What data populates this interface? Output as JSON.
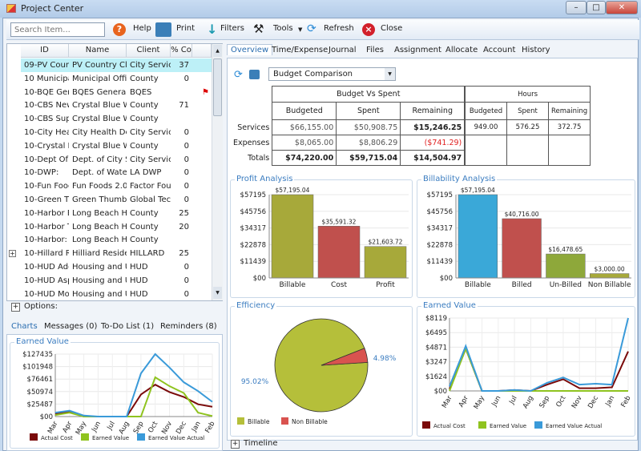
{
  "window": {
    "title": "Project Center",
    "controls": [
      "–",
      "□",
      "✕"
    ]
  },
  "toolbar": {
    "search_placeholder": "Search Item...",
    "help": "Help",
    "print": "Print",
    "filters": "Filters",
    "tools": "Tools",
    "refresh": "Refresh",
    "close": "Close"
  },
  "grid": {
    "columns": [
      "ID",
      "Name",
      "Client",
      "% Co",
      ""
    ],
    "rows": [
      [
        "09-PV Count",
        "PV Country Clu",
        "City Servic",
        "37"
      ],
      [
        "10 Municipal",
        "Municipal Offic",
        "County",
        "0"
      ],
      [
        "10-BQE Gen",
        "BQES General",
        "BQES",
        ""
      ],
      [
        "10-CBS New",
        "Crystal Blue Wa",
        "County",
        "71"
      ],
      [
        "10-CBS Supp",
        "Crystal Blue Wa",
        "County",
        ""
      ],
      [
        "10-City Healt",
        "City Health Dep",
        "City Servic",
        "0"
      ],
      [
        "10-Crystal Bl",
        "Crystal Blue Wa",
        "County",
        "0"
      ],
      [
        "10-Dept Of",
        "Dept. of City Se",
        "City Servic",
        "0"
      ],
      [
        "10-DWP:",
        "Dept. of Water",
        "LA DWP",
        "0"
      ],
      [
        "10-Fun Food",
        "Fun Foods 2.0",
        "Factor Fou",
        "0"
      ],
      [
        "10-Green Th",
        "Green Thumb S",
        "Global Tec",
        "0"
      ],
      [
        "10-Harbor Bl",
        "Long Beach Har",
        "County",
        "25"
      ],
      [
        "10-Harbor T",
        "Long Beach Har",
        "County",
        "20"
      ],
      [
        "10-Harbor:",
        "Long Beach Har",
        "County",
        ""
      ],
      [
        "10-Hillard Re",
        "Hilliard Residen",
        "HILLARD",
        "25"
      ],
      [
        "10-HUD Add",
        "Housing and Ur",
        "HUD",
        "0"
      ],
      [
        "10-HUD Asp",
        "Housing and Ur",
        "HUD",
        "0"
      ],
      [
        "10-HUD Mo",
        "Housing and Ur",
        "HUD",
        "0"
      ]
    ]
  },
  "options_label": "Options:",
  "bottom_tabs": [
    "Charts",
    "Messages  (0)",
    "To-Do List  (1)",
    "Reminders  (8)"
  ],
  "main_tabs": [
    "Overview",
    "Time/Expense",
    "Journal",
    "Files",
    "Assignment",
    "Allocate",
    "Account",
    "History"
  ],
  "report_select": "Budget Comparison",
  "budget": {
    "title": "Budget Vs Spent",
    "headers": [
      "Budgeted",
      "Spent",
      "Remaining"
    ],
    "rows": [
      {
        "label": "Services",
        "values": [
          "$66,155.00",
          "$50,908.75",
          "$15,246.25"
        ]
      },
      {
        "label": "Expenses",
        "values": [
          "$8,065.00",
          "$8,806.29",
          "($741.29)"
        ]
      },
      {
        "label": "Totals",
        "values": [
          "$74,220.00",
          "$59,715.04",
          "$14,504.97"
        ]
      }
    ],
    "negative_color": "#e02020"
  },
  "hours": {
    "title": "Hours",
    "headers": [
      "Budgeted",
      "Spent",
      "Remaining"
    ],
    "values": [
      "949.00",
      "576.25",
      "372.75"
    ]
  },
  "timeline_label": "Timeline",
  "chart_data": [
    {
      "id": "profit",
      "type": "bar",
      "title": "Profit Analysis",
      "categories": [
        "Billable",
        "Cost",
        "Profit"
      ],
      "values": [
        57195.04,
        35591.32,
        21603.72
      ],
      "labels": [
        "$57,195.04",
        "$35,591.32",
        "$21,603.72"
      ],
      "yticks": [
        "$00",
        "$11439",
        "$22878",
        "$34317",
        "$45756",
        "$57195"
      ],
      "ylim": [
        0,
        57195
      ],
      "colors": [
        "#a7a93a",
        "#c0504d",
        "#a7a93a"
      ]
    },
    {
      "id": "billability",
      "type": "bar",
      "title": "Billability Analysis",
      "categories": [
        "Billable",
        "Billed",
        "Un-Billed",
        "Non Billable"
      ],
      "values": [
        57195.04,
        40716,
        16478.65,
        3000
      ],
      "labels": [
        "$57,195.04",
        "$40,716.00",
        "$16,478.65",
        "$3,000.00"
      ],
      "yticks": [
        "$00",
        "$11439",
        "$22878",
        "$34317",
        "$45756",
        "$57195"
      ],
      "ylim": [
        0,
        57195
      ],
      "colors": [
        "#3aa8d8",
        "#c0504d",
        "#8ea83a",
        "#a7a93a"
      ]
    },
    {
      "id": "efficiency",
      "type": "pie",
      "title": "Efficiency",
      "slices": [
        {
          "name": "Billable",
          "value": 95.02,
          "label": "95.02%",
          "color": "#b5bf3a"
        },
        {
          "name": "Non Billable",
          "value": 4.98,
          "label": "4.98%",
          "color": "#d9534f"
        }
      ]
    },
    {
      "id": "ev-main",
      "type": "line",
      "title": "Earned Value",
      "categories": [
        "Mar",
        "Apr",
        "May",
        "Jun",
        "Jul",
        "Aug",
        "Sep",
        "Oct",
        "Nov",
        "Dec",
        "Jan",
        "Feb"
      ],
      "yticks": [
        "$00",
        "$1624",
        "$3247",
        "$4871",
        "$6495",
        "$8119"
      ],
      "ylim": [
        0,
        8119
      ],
      "series": [
        {
          "name": "Actual Cost",
          "color": "#7a0a0a",
          "values": [
            200,
            4700,
            0,
            0,
            100,
            0,
            700,
            1300,
            300,
            300,
            400,
            4400
          ]
        },
        {
          "name": "Earned Value",
          "color": "#8fc31f",
          "values": [
            0,
            4700,
            0,
            0,
            0,
            0,
            0,
            0,
            0,
            0,
            0,
            0
          ]
        },
        {
          "name": "Earned Value Actual",
          "color": "#3a9ad9",
          "values": [
            500,
            5000,
            0,
            0,
            100,
            0,
            900,
            1500,
            700,
            800,
            700,
            8119
          ]
        }
      ]
    },
    {
      "id": "ev-side",
      "type": "line",
      "title": "Earned Value",
      "categories": [
        "Mar",
        "Apr",
        "May",
        "Jun",
        "Jul",
        "Aug",
        "Sep",
        "Oct",
        "Nov",
        "Dec",
        "Jan",
        "Feb"
      ],
      "yticks": [
        "$00",
        "$25487",
        "$50974",
        "$76461",
        "$101948",
        "$127435"
      ],
      "ylim": [
        0,
        127435
      ],
      "series": [
        {
          "name": "Actual Cost",
          "color": "#7a0a0a",
          "values": [
            5000,
            10000,
            0,
            0,
            0,
            0,
            45000,
            65000,
            50000,
            40000,
            25000,
            20000
          ]
        },
        {
          "name": "Earned Value",
          "color": "#8fc31f",
          "values": [
            3000,
            8000,
            0,
            0,
            0,
            0,
            0,
            80000,
            62000,
            48000,
            8000,
            1000
          ]
        },
        {
          "name": "Earned Value Actual",
          "color": "#3a9ad9",
          "values": [
            8000,
            12000,
            2000,
            0,
            0,
            0,
            88000,
            127435,
            100000,
            70000,
            52000,
            30000
          ]
        }
      ]
    }
  ]
}
